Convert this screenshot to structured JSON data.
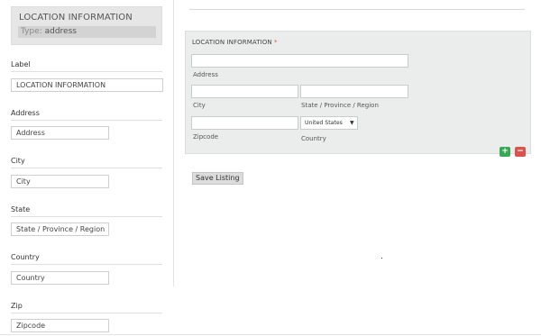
{
  "field_header": {
    "title": "LOCATION INFORMATION",
    "type_label": "Type:",
    "type_value": "address"
  },
  "left_fields": [
    {
      "label": "Label",
      "value": "LOCATION INFORMATION"
    },
    {
      "label": "Address",
      "value": "Address"
    },
    {
      "label": "City",
      "value": "City"
    },
    {
      "label": "State",
      "value": "State  / Province / Region"
    },
    {
      "label": "Country",
      "value": "Country"
    },
    {
      "label": "Zip",
      "value": "Zipcode"
    }
  ],
  "location_form": {
    "title": "LOCATION INFORMATION",
    "required_mark": "*",
    "captions": {
      "address": "Address",
      "city": "City",
      "state": "State / Province / Region",
      "zipcode": "Zipcode",
      "country": "Country"
    },
    "country_selected": "United States",
    "country_arrow": "▼",
    "add_symbol": "+",
    "remove_symbol": "−"
  },
  "save_button_label": "Save Listing",
  "colors": {
    "panel_bg": "#ebeded",
    "header_bg": "#e6e6e6",
    "add": "#3aa856",
    "remove": "#d9534f",
    "required": "#d9534f"
  }
}
